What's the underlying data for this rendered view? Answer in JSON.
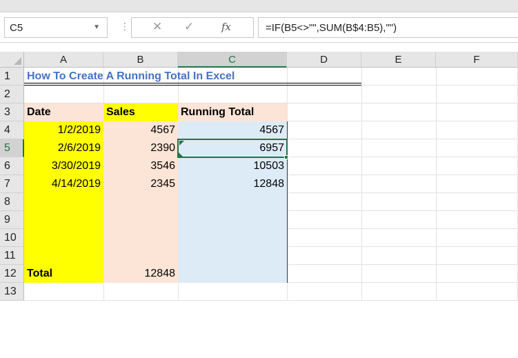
{
  "namebox": {
    "value": "C5"
  },
  "formula_bar": {
    "cancel_glyph": "✕",
    "enter_glyph": "✓",
    "fx_label": "fx",
    "formula": "=IF(B5<>\"\",SUM(B$4:B5),\"\")"
  },
  "columns": [
    "A",
    "B",
    "C",
    "D",
    "E",
    "F"
  ],
  "selected_column": "C",
  "rows": [
    "1",
    "2",
    "3",
    "4",
    "5",
    "6",
    "7",
    "8",
    "9",
    "10",
    "11",
    "12",
    "13"
  ],
  "selected_row": "5",
  "sheet": {
    "title": "How To Create A Running Total In Excel",
    "headers": {
      "date": "Date",
      "sales": "Sales",
      "running_total": "Running Total"
    },
    "data_rows": [
      {
        "date": "1/2/2019",
        "sales": "4567",
        "running_total": "4567"
      },
      {
        "date": "2/6/2019",
        "sales": "2390",
        "running_total": "6957"
      },
      {
        "date": "3/30/2019",
        "sales": "3546",
        "running_total": "10503"
      },
      {
        "date": "4/14/2019",
        "sales": "2345",
        "running_total": "12848"
      }
    ],
    "total_label": "Total",
    "total_value": "12848"
  },
  "colors": {
    "title_blue": "#4472c4",
    "date_column_fill": "#ffff00",
    "sales_column_fill": "#fce4d6",
    "running_total_fill": "#ddebf7",
    "selection_green": "#217346"
  }
}
